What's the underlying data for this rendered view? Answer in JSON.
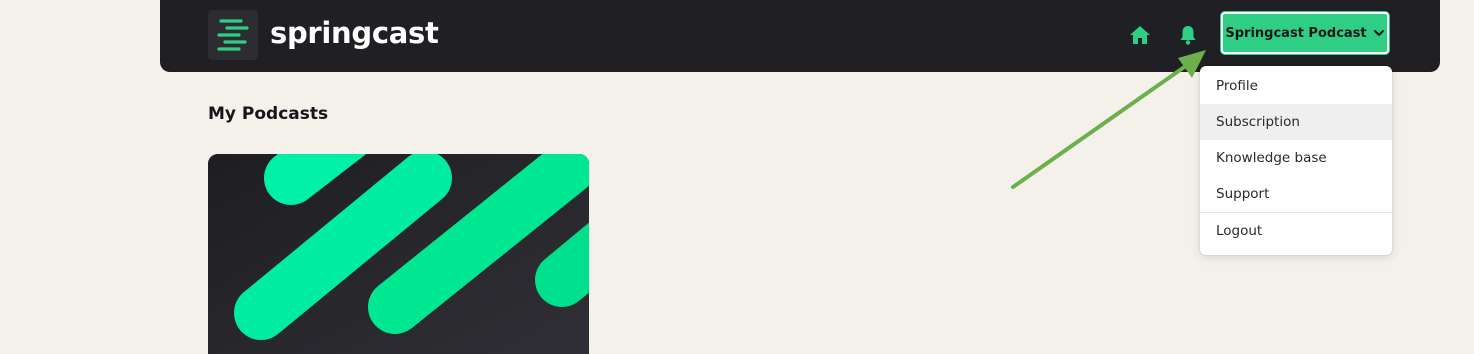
{
  "brand": {
    "name": "springcast",
    "accent": "#2ecf85",
    "nav_bg": "#1f1f24"
  },
  "header": {
    "icons": [
      "home-icon",
      "bell-icon"
    ],
    "account_label": "Springcast Podcast"
  },
  "main": {
    "title": "My Podcasts"
  },
  "dropdown": {
    "items": [
      {
        "label": "Profile"
      },
      {
        "label": "Subscription",
        "highlighted": true
      },
      {
        "label": "Knowledge base"
      },
      {
        "label": "Support"
      },
      {
        "label": "Logout"
      }
    ]
  },
  "annotation": {
    "arrow_color": "#6bb04a"
  }
}
